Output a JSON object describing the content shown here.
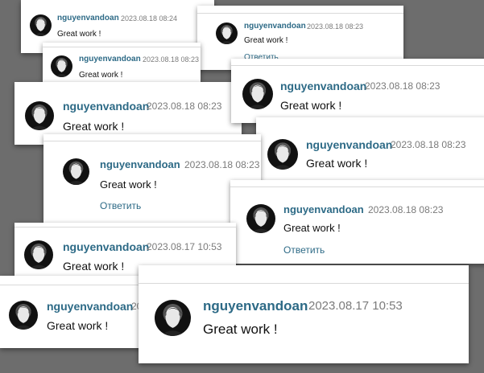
{
  "comments": [
    {
      "author": "nguyenvandoan",
      "date": "2023.08.18 08:24",
      "text": "Great work !"
    },
    {
      "author": "nguyenvandoan",
      "date": "2023.08.18 08:23",
      "text": "Great work !",
      "reply": "Ответить"
    },
    {
      "author": "nguyenvandoan",
      "date": "2023.08.18 08:23",
      "text": "Great work !"
    },
    {
      "author": "nguyenvandoan",
      "date": "2023.08.18 08:23",
      "text": "Great work !"
    },
    {
      "author": "nguyenvandoan",
      "date": "2023.08.18 08:23",
      "text": "Great work !"
    },
    {
      "author": "nguyenvandoan",
      "date": "2023.08.18 08:23",
      "text": "Great work !"
    },
    {
      "author": "nguyenvandoan",
      "date": "2023.08.18 08:23",
      "text": "Great work !",
      "reply": "Ответить"
    },
    {
      "author": "nguyenvandoan",
      "date": "2023.08.18 08:23",
      "text": "Great work !",
      "reply": "Ответить"
    },
    {
      "author": "nguyenvandoan",
      "date": "2023.08.17 10:53",
      "text": "Great work !"
    },
    {
      "author": "nguyenvandoan",
      "date": "2023.08.17 10:53",
      "text": "Great work !"
    },
    {
      "author": "nguyenvandoan",
      "date": "2023.08.17 10:53",
      "text": "Great work !"
    }
  ]
}
